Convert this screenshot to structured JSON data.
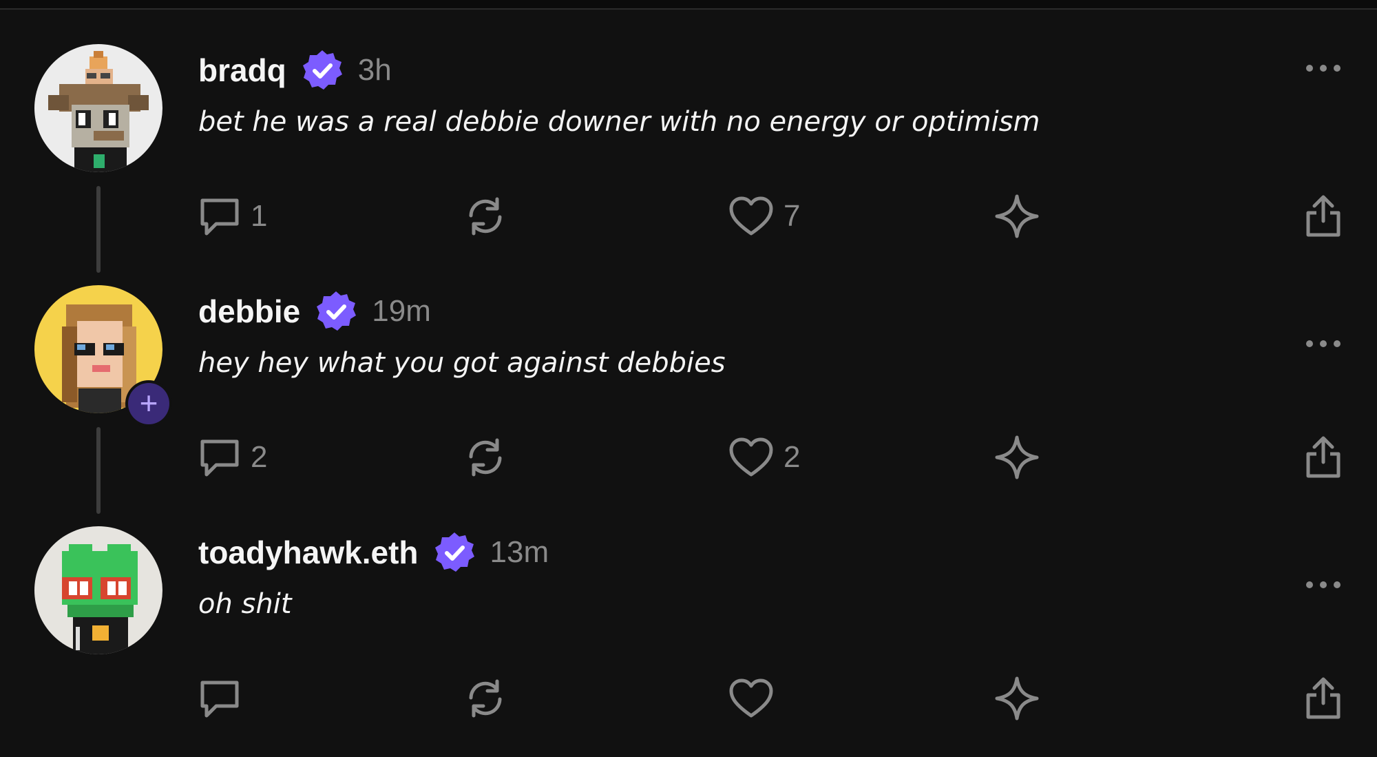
{
  "posts": [
    {
      "username": "bradq",
      "time": "3h",
      "text": "bet he was a real debbie downer with no energy or optimism",
      "replies": "1",
      "reposts": "",
      "likes": "7",
      "avatar_bg": "#ececec"
    },
    {
      "username": "debbie",
      "time": "19m",
      "text": "hey hey what you got against debbies",
      "replies": "2",
      "reposts": "",
      "likes": "2",
      "avatar_bg": "#f5d24b"
    },
    {
      "username": "toadyhawk.eth",
      "time": "13m",
      "text": "oh shit",
      "replies": "",
      "reposts": "",
      "likes": "",
      "avatar_bg": "#e6e4df"
    }
  ],
  "colors": {
    "background": "#111111",
    "verified": "#7c5cff",
    "muted": "#8a8a8a",
    "icon": "#8a8a8a",
    "thread_line": "#3d3d3d"
  },
  "icons": {
    "verified": "verified-badge-icon",
    "more": "more-options-icon",
    "reply": "reply-icon",
    "repost": "repost-icon",
    "like": "heart-icon",
    "save": "sparkle-icon",
    "share": "share-icon",
    "follow": "plus-icon"
  }
}
